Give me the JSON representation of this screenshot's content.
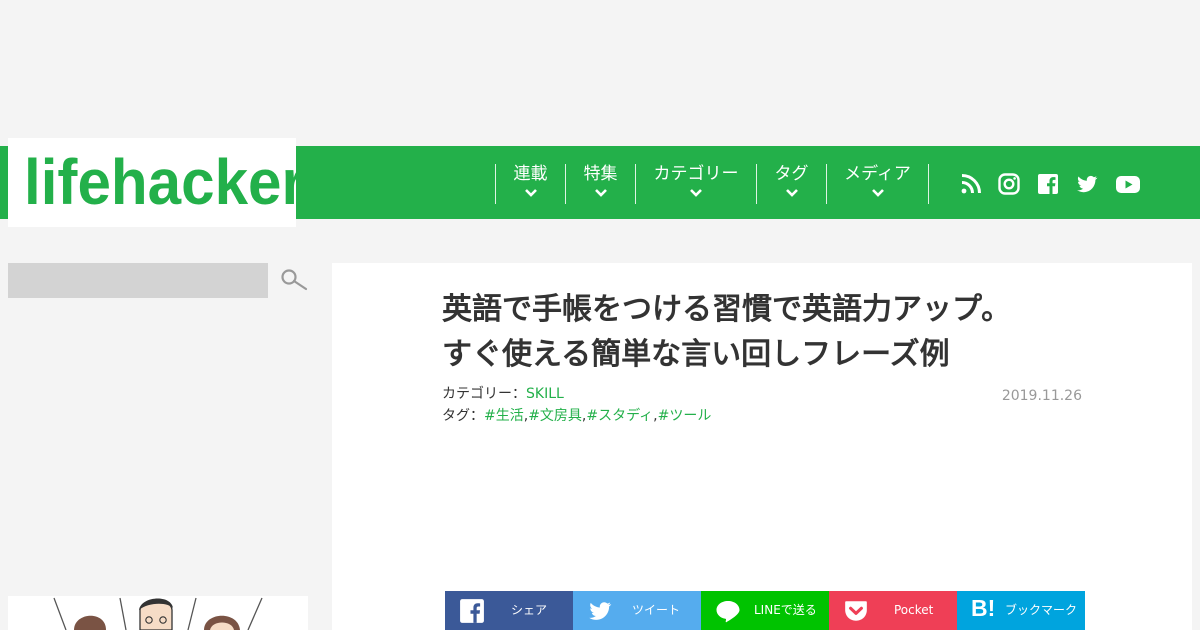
{
  "header": {
    "logo": "lifehacker",
    "nav": [
      {
        "label": "連載"
      },
      {
        "label": "特集"
      },
      {
        "label": "カテゴリー"
      },
      {
        "label": "タグ"
      },
      {
        "label": "メディア"
      }
    ],
    "social_icons": [
      "rss-icon",
      "instagram-icon",
      "facebook-icon",
      "twitter-icon",
      "youtube-icon"
    ]
  },
  "search": {
    "placeholder": ""
  },
  "article": {
    "title_line1": "英語で手帳をつける習慣で英語力アップ。",
    "title_line2": "すぐ使える簡単な言い回しフレーズ例",
    "category_label": "カテゴリー：",
    "category": "SKILL",
    "tags_label": "タグ：",
    "tags": [
      "#生活",
      "#文房具",
      "#スタディ",
      "#ツール"
    ],
    "tag_separator": ",",
    "date": "2019.11.26"
  },
  "share": [
    {
      "label": "シェア",
      "color": "#3b5998",
      "icon": "facebook-icon"
    },
    {
      "label": "ツイート",
      "color": "#55acee",
      "icon": "twitter-icon"
    },
    {
      "label": "LINEで送る",
      "color": "#00c300",
      "icon": "line-icon"
    },
    {
      "label": "Pocket",
      "color": "#ef3f56",
      "icon": "pocket-icon"
    },
    {
      "label": "ブックマーク",
      "color": "#00a4de",
      "icon": "hatena-bookmark-icon"
    }
  ],
  "colors": {
    "brand": "#23b04a",
    "background": "#f4f4f4",
    "date": "#999999"
  }
}
